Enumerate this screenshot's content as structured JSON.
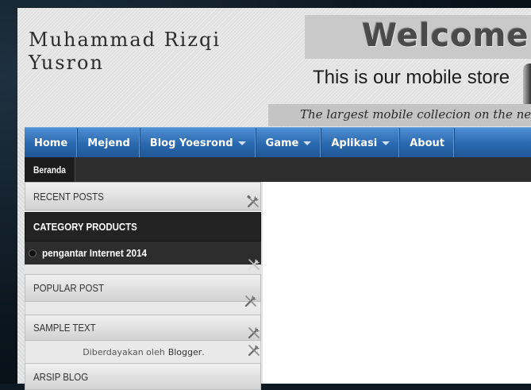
{
  "header": {
    "site_title": "Muhammad Rizqi Yusron",
    "welcome": "Welcome",
    "subtitle": "This is our mobile store",
    "tagline": "The largest mobile collecion on the net"
  },
  "nav": {
    "items": [
      {
        "label": "Home",
        "has_dropdown": false
      },
      {
        "label": "Mejend",
        "has_dropdown": false
      },
      {
        "label": "Blog Yoesrond",
        "has_dropdown": true
      },
      {
        "label": "Game",
        "has_dropdown": true
      },
      {
        "label": "Aplikasi",
        "has_dropdown": true
      },
      {
        "label": "About",
        "has_dropdown": false
      }
    ]
  },
  "subnav": {
    "items": [
      {
        "label": "Beranda"
      }
    ]
  },
  "sidebar": {
    "recent_posts": "RECENT POSTS",
    "category_products": "CATEGORY PRODUCTS",
    "category_link": "pengantar Internet 2014",
    "popular_post": "POPULAR POST",
    "sample_text": "SAMPLE TEXT",
    "powered_by_prefix": "Diberdayakan oleh",
    "powered_by_link": "Blogger",
    "powered_by_suffix": ".",
    "archive": "ARSIP BLOG"
  },
  "icons": {
    "widget_edit": "tools-icon"
  },
  "colors": {
    "nav_blue": "#2a67ad",
    "dark_bar": "#232323",
    "page_bg": "#0d1a24"
  }
}
